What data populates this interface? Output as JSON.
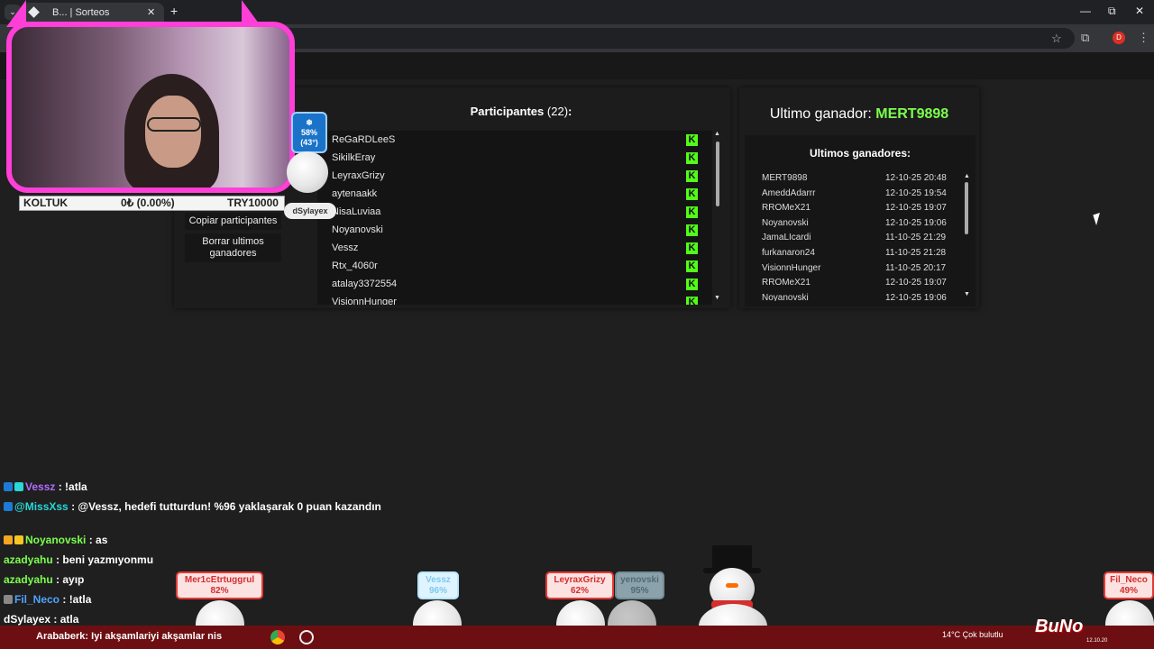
{
  "browser": {
    "tab_title": "B... | Sorteos",
    "tab_close": "✕",
    "new_tab": "+",
    "tab_search": "⌄",
    "win_min": "—",
    "win_max": "⧉",
    "win_close": "✕",
    "star_icon": "☆",
    "ext_icon": "⧉",
    "profile_letter": "D",
    "menu_icon": "⋮"
  },
  "actions": {
    "copy": "Copiar participantes",
    "clear": "Borrar ultimos ganadores"
  },
  "participants": {
    "title": "Participantes",
    "count": "(22)",
    "colon": ":",
    "items": [
      "ReGaRDLeeS",
      "SikilkEray",
      "LeyraxGrizy",
      "aytenaakk",
      "NisaLuviaa",
      "Noyanovski",
      "Vessz",
      "Rtx_4060r",
      "atalay3372554",
      "VisionnHunger"
    ],
    "badge": "K"
  },
  "last_winner": {
    "label": "Ultimo ganador:",
    "name": "MERT9898"
  },
  "winners": {
    "title": "Ultimos ganadores:",
    "rows": [
      {
        "name": "MERT9898",
        "date": "12-10-25 20:48"
      },
      {
        "name": "AmeddAdarrr",
        "date": "12-10-25 19:54"
      },
      {
        "name": "RROMeX21",
        "date": "12-10-25 19:07"
      },
      {
        "name": "Noyanovski",
        "date": "12-10-25 19:06"
      },
      {
        "name": "JamaLIcardi",
        "date": "11-10-25 21:29"
      },
      {
        "name": "furkanaron24",
        "date": "11-10-25 21:28"
      },
      {
        "name": "VisionnHunger",
        "date": "11-10-25 20:17"
      },
      {
        "name": "RROMeX21",
        "date": "12-10-25 19:07"
      },
      {
        "name": "Noyanovski",
        "date": "12-10-25 19:06"
      }
    ]
  },
  "overlay": {
    "ticker_label": "KOLTUK",
    "ticker_value": "0₺ (0.00%)",
    "ticker_target": "TRY10000",
    "temp_pct": "58%",
    "temp_deg": "(43°)",
    "snow_icon": "❄",
    "ball_name": "dSylayex"
  },
  "chat": [
    {
      "user": "Vessz",
      "sep": " : ",
      "msg": "!atla",
      "color": "#b06cff"
    },
    {
      "user": "@MissXss",
      "sep": " : ",
      "msg": "@Vessz, hedefi tutturdun! %96 yaklaşarak 0 puan kazandın",
      "color": "#2ad6d6"
    },
    {
      "user": "Noyanovski",
      "sep": " : ",
      "msg": "as",
      "color": "#7cff4d"
    },
    {
      "user": "azadyahu",
      "sep": " : ",
      "msg": "beni yazmıyonmu",
      "color": "#7cff4d"
    },
    {
      "user": "azadyahu",
      "sep": " : ",
      "msg": "ayıp",
      "color": "#7cff4d"
    },
    {
      "user": "Fil_Neco",
      "sep": " : ",
      "msg": "!atla",
      "color": "#4fa3ff"
    },
    {
      "user": "dSylayex",
      "sep": " : ",
      "msg": "atla",
      "color": "#ffffff"
    }
  ],
  "balls": [
    {
      "name": "Mer1cEtrtuggrul",
      "pct": "82%"
    },
    {
      "name": "Vessz",
      "pct": "96%"
    },
    {
      "name": "LeyraxGrizy",
      "pct": "62%"
    },
    {
      "name": "yenovski",
      "pct": "95%"
    },
    {
      "name": "Fil_Neco",
      "pct": "49%"
    }
  ],
  "taskbar": {
    "ticker": "Arababerk: Iyi akşamlariyi akşamlar nis",
    "weather": "14°C  Çok bulutlu",
    "logo": "BuNo",
    "date": "12.10.20"
  }
}
